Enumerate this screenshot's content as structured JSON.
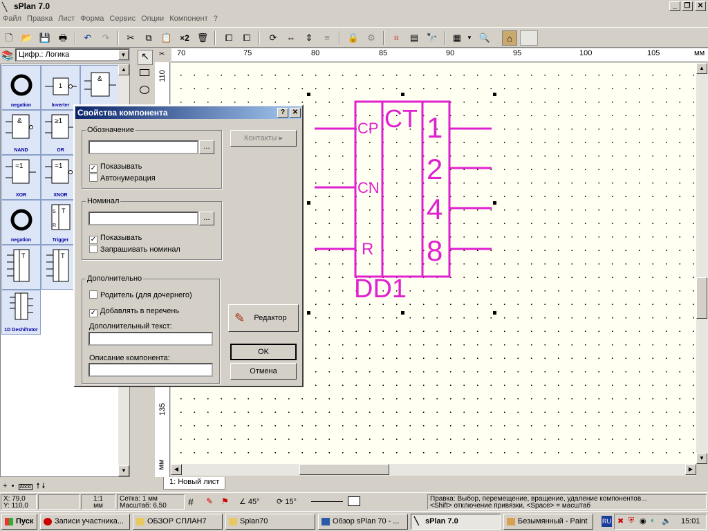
{
  "window": {
    "title": "sPlan 7.0",
    "controls": [
      "_",
      "❐",
      "✕"
    ]
  },
  "menu": [
    "Файл",
    "Правка",
    "Лист",
    "Форма",
    "Сервис",
    "Опции",
    "Компонент",
    "?"
  ],
  "toolbar": {
    "x2_label": "×2"
  },
  "library": {
    "selected": "Цифр.: Логика",
    "items": [
      "negation",
      "Inverter",
      "",
      "NAND",
      "OR",
      "",
      "XOR",
      "XNOR",
      "",
      "negation",
      "Trigger",
      "",
      "",
      "",
      "",
      "1D Deshifrator"
    ]
  },
  "rulers": {
    "top": [
      "70",
      "75",
      "80",
      "85",
      "90",
      "95",
      "100",
      "105",
      "мм"
    ],
    "left": [
      "110",
      "135",
      "мм"
    ]
  },
  "schematic": {
    "block_label": "CT",
    "inputs": [
      "CP",
      "CN",
      "R"
    ],
    "outputs": [
      "1",
      "2",
      "4",
      "8"
    ],
    "designator": "DD1",
    "color": "#e020d0"
  },
  "dialog": {
    "title": "Свойства компонента",
    "help": "?",
    "close": "✕",
    "designation": {
      "legend": "Обозначение",
      "value": "",
      "browse": "...",
      "show": "Показывать",
      "auto": "Автонумерация"
    },
    "contacts_button": "Контакты",
    "nominal": {
      "legend": "Номинал",
      "value": "",
      "browse": "...",
      "show": "Показывать",
      "ask": "Запрашивать номинал"
    },
    "extra": {
      "legend": "Дополнительно",
      "parent": "Родитель (для дочернего)",
      "add": "Добавлять в перечень",
      "text_label": "Дополнительный текст:",
      "desc_label": "Описание компонента:"
    },
    "editor_button": "Редактор",
    "ok": "OK",
    "cancel": "Отмена"
  },
  "sheet_tab": "1: Новый лист",
  "status": {
    "x": "X: 79,0",
    "y": "Y: 110,0",
    "scale1": "1:1",
    "unit": "мм",
    "grid": "Сетка: 1 мм",
    "zoom": "Масштаб:  6,50",
    "angle1": "45°",
    "angle2": "15°",
    "hint1": "Правка: Выбор, перемещение, вращение, удаление компонентов...",
    "hint2": "<Shift> отключение привязки, <Space> = масштаб"
  },
  "taskbar": {
    "start": "Пуск",
    "tasks": [
      "Записи участника...",
      "ОБЗОР СПЛАН7",
      "Splan70",
      "Обзор sPlan 70 - ...",
      "sPlan 7.0",
      "Безымянный - Paint"
    ],
    "lang": "RU",
    "clock": "15:01"
  }
}
